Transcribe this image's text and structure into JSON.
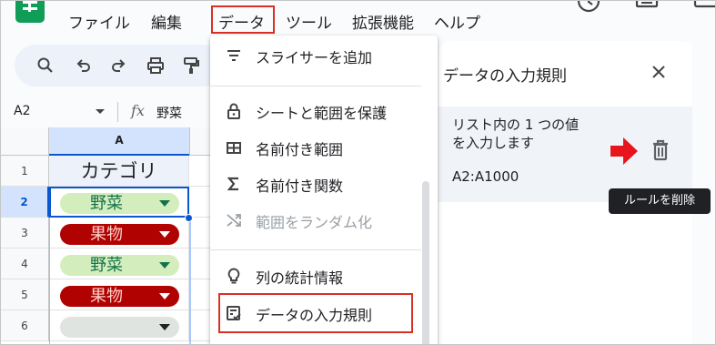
{
  "menubar": {
    "items": [
      "ファイル",
      "編集",
      "データ",
      "ツール",
      "拡張機能",
      "ヘルプ"
    ],
    "highlighted": "データ"
  },
  "formula_bar": {
    "cell_ref": "A2",
    "fx_label": "fx",
    "value": "野菜"
  },
  "grid": {
    "column_header": "A",
    "rows": [
      "1",
      "2",
      "3",
      "4",
      "5",
      "6"
    ],
    "header_cell": "カテゴリ",
    "cells": [
      {
        "label": "野菜",
        "type": "veg"
      },
      {
        "label": "果物",
        "type": "fruit"
      },
      {
        "label": "野菜",
        "type": "veg"
      },
      {
        "label": "果物",
        "type": "fruit"
      },
      {
        "label": "",
        "type": "empty"
      }
    ],
    "colors": {
      "veg_bg": "#d4edbc",
      "veg_text": "#11734b",
      "fruit_bg": "#b10202",
      "fruit_text": "#ffcfc9",
      "empty_bg": "#e0e4e0"
    }
  },
  "data_menu": {
    "items": [
      {
        "label": "スライサーを追加",
        "icon": "filter-lines-icon"
      },
      {
        "label": "シートと範囲を保護",
        "icon": "lock-icon"
      },
      {
        "label": "名前付き範囲",
        "icon": "named-range-icon"
      },
      {
        "label": "名前付き関数",
        "icon": "sigma-icon"
      },
      {
        "label": "範囲をランダム化",
        "icon": "shuffle-icon",
        "disabled": true
      },
      {
        "label": "列の統計情報",
        "icon": "lightbulb-icon"
      },
      {
        "label": "データの入力規則",
        "icon": "data-validation-icon",
        "highlighted": true
      }
    ]
  },
  "panel": {
    "title": "データの入力規則",
    "rule_desc_line1": "リスト内の 1 つの値",
    "rule_desc_line2": "を入力します",
    "rule_range": "A2:A1000",
    "delete_tooltip": "ルールを削除"
  },
  "colors": {
    "highlight_red": "#d93025",
    "accent_blue": "#0b57d0",
    "sheets_green": "#0f9d58"
  }
}
